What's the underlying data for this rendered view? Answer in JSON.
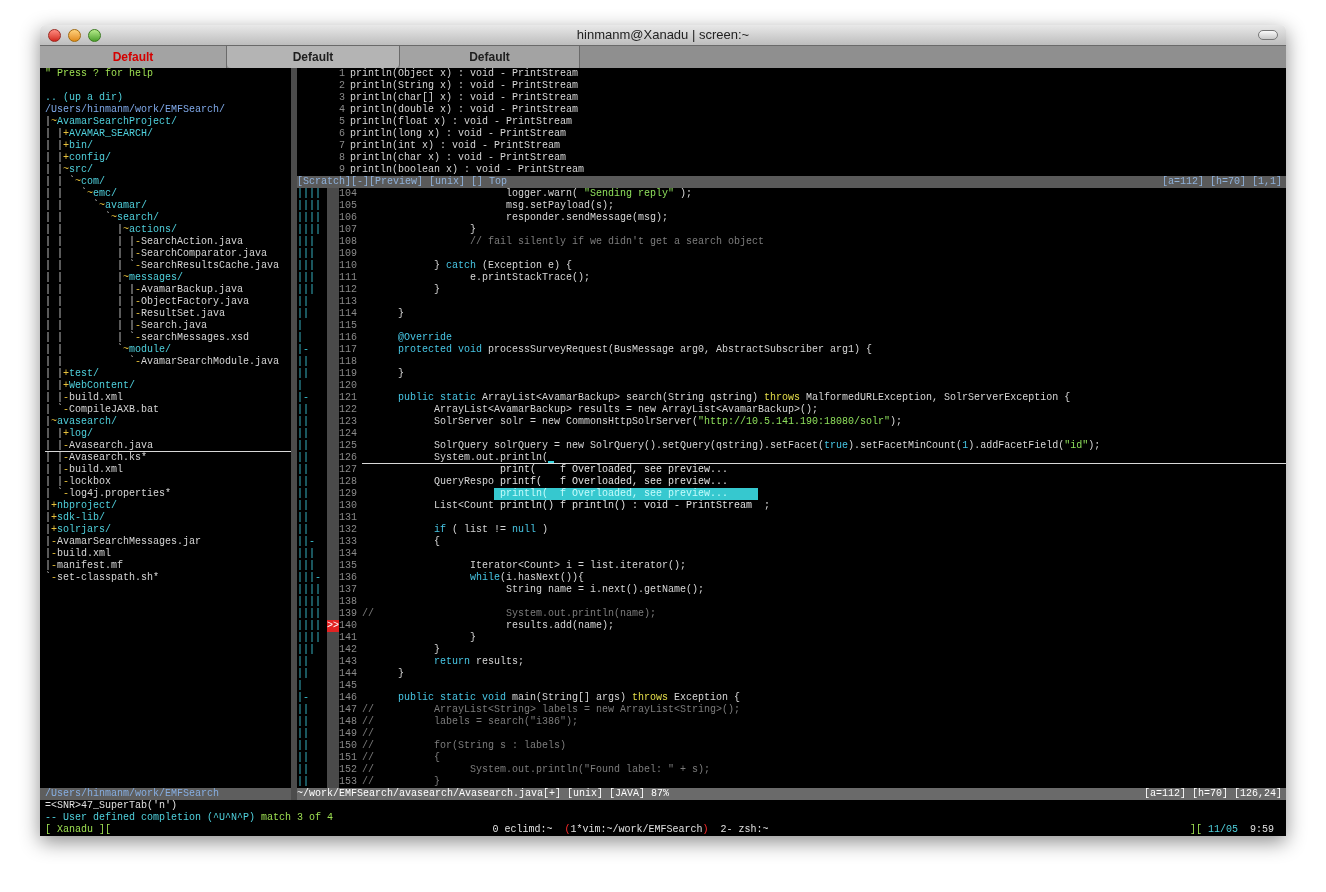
{
  "window": {
    "title": "hinmanm@Xanadu | screen:~"
  },
  "tabs": [
    {
      "label": "Default",
      "selected": false,
      "alert": true
    },
    {
      "label": "Default",
      "selected": true,
      "alert": false
    },
    {
      "label": "Default",
      "selected": false,
      "alert": false
    }
  ],
  "file_tree": {
    "help": "\" Press ? for help",
    "up": ".. (up a dir)",
    "root": "/Users/hinmanm/work/EMFSearch/",
    "nodes": [
      {
        "prefix": "|",
        "marker": "~",
        "name": "AvamarSearchProject/",
        "kind": "dir",
        "selected": false,
        "children": [
          {
            "prefix": "| |",
            "marker": "+",
            "name": "AVAMAR_SEARCH/",
            "kind": "dir",
            "selected": false
          },
          {
            "prefix": "| |",
            "marker": "+",
            "name": "bin/",
            "kind": "dir",
            "selected": false
          },
          {
            "prefix": "| |",
            "marker": "+",
            "name": "config/",
            "kind": "dir",
            "selected": false
          },
          {
            "prefix": "| |",
            "marker": "~",
            "name": "src/",
            "kind": "dir",
            "selected": false,
            "children": [
              {
                "prefix": "| | `",
                "marker": "~",
                "name": "com/",
                "kind": "dir",
                "selected": false,
                "children": [
                  {
                    "prefix": "| |   `",
                    "marker": "~",
                    "name": "emc/",
                    "kind": "dir",
                    "selected": false,
                    "children": [
                      {
                        "prefix": "| |     `",
                        "marker": "~",
                        "name": "avamar/",
                        "kind": "dir",
                        "selected": false,
                        "children": [
                          {
                            "prefix": "| |       `",
                            "marker": "~",
                            "name": "search/",
                            "kind": "dir",
                            "selected": false,
                            "children": [
                              {
                                "prefix": "| |         |",
                                "marker": "~",
                                "name": "actions/",
                                "kind": "dir",
                                "selected": false,
                                "children": [
                                  {
                                    "prefix": "| |         | |",
                                    "marker": "-",
                                    "name": "SearchAction.java",
                                    "kind": "file",
                                    "selected": false
                                  },
                                  {
                                    "prefix": "| |         | |",
                                    "marker": "-",
                                    "name": "SearchComparator.java",
                                    "kind": "file",
                                    "selected": false
                                  },
                                  {
                                    "prefix": "| |         | `",
                                    "marker": "-",
                                    "name": "SearchResultsCache.java",
                                    "kind": "file",
                                    "selected": false
                                  }
                                ]
                              },
                              {
                                "prefix": "| |         |",
                                "marker": "~",
                                "name": "messages/",
                                "kind": "dir",
                                "selected": false,
                                "children": [
                                  {
                                    "prefix": "| |         | |",
                                    "marker": "-",
                                    "name": "AvamarBackup.java",
                                    "kind": "file",
                                    "selected": false
                                  },
                                  {
                                    "prefix": "| |         | |",
                                    "marker": "-",
                                    "name": "ObjectFactory.java",
                                    "kind": "file",
                                    "selected": false
                                  },
                                  {
                                    "prefix": "| |         | |",
                                    "marker": "-",
                                    "name": "ResultSet.java",
                                    "kind": "file",
                                    "selected": false
                                  },
                                  {
                                    "prefix": "| |         | |",
                                    "marker": "-",
                                    "name": "Search.java",
                                    "kind": "file",
                                    "selected": false
                                  },
                                  {
                                    "prefix": "| |         | `",
                                    "marker": "-",
                                    "name": "searchMessages.xsd",
                                    "kind": "file",
                                    "selected": false
                                  }
                                ]
                              },
                              {
                                "prefix": "| |         `",
                                "marker": "~",
                                "name": "module/",
                                "kind": "dir",
                                "selected": false,
                                "children": [
                                  {
                                    "prefix": "| |           `",
                                    "marker": "-",
                                    "name": "AvamarSearchModule.java",
                                    "kind": "file",
                                    "selected": false
                                  }
                                ]
                              }
                            ]
                          }
                        ]
                      }
                    ]
                  }
                ]
              }
            ]
          },
          {
            "prefix": "| |",
            "marker": "+",
            "name": "test/",
            "kind": "dir",
            "selected": false
          },
          {
            "prefix": "| |",
            "marker": "+",
            "name": "WebContent/",
            "kind": "dir",
            "selected": false
          },
          {
            "prefix": "| |",
            "marker": "-",
            "name": "build.xml",
            "kind": "file",
            "selected": false
          },
          {
            "prefix": "| `",
            "marker": "-",
            "name": "CompileJAXB.bat",
            "kind": "file",
            "selected": false
          }
        ]
      },
      {
        "prefix": "|",
        "marker": "~",
        "name": "avasearch/",
        "kind": "dir",
        "selected": false,
        "children": [
          {
            "prefix": "| |",
            "marker": "+",
            "name": "log/",
            "kind": "dir",
            "selected": false
          },
          {
            "prefix": "| |",
            "marker": "-",
            "name": "Avasearch.java",
            "kind": "file",
            "selected": true
          },
          {
            "prefix": "| |",
            "marker": "-",
            "name": "Avasearch.ks*",
            "kind": "file",
            "selected": false
          },
          {
            "prefix": "| |",
            "marker": "-",
            "name": "build.xml",
            "kind": "file",
            "selected": false
          },
          {
            "prefix": "| |",
            "marker": "-",
            "name": "lockbox",
            "kind": "file",
            "selected": false
          },
          {
            "prefix": "| `",
            "marker": "-",
            "name": "log4j.properties*",
            "kind": "file",
            "selected": false
          }
        ]
      },
      {
        "prefix": "|",
        "marker": "+",
        "name": "nbproject/",
        "kind": "dir",
        "selected": false
      },
      {
        "prefix": "|",
        "marker": "+",
        "name": "sdk-lib/",
        "kind": "dir",
        "selected": false
      },
      {
        "prefix": "|",
        "marker": "+",
        "name": "solrjars/",
        "kind": "dir",
        "selected": false
      },
      {
        "prefix": "|",
        "marker": "-",
        "name": "AvamarSearchMessages.jar",
        "kind": "file",
        "selected": false
      },
      {
        "prefix": "|",
        "marker": "-",
        "name": "build.xml",
        "kind": "file",
        "selected": false
      },
      {
        "prefix": "|",
        "marker": "-",
        "name": "manifest.mf",
        "kind": "file",
        "selected": false
      },
      {
        "prefix": "`",
        "marker": "-",
        "name": "set-classpath.sh*",
        "kind": "file",
        "selected": false
      }
    ],
    "status": "/Users/hinmanm/work/EMFSearch"
  },
  "preview": {
    "lines": [
      {
        "num": "1",
        "text": "println(Object x) : void - PrintStream"
      },
      {
        "num": "2",
        "text": "println(String x) : void - PrintStream"
      },
      {
        "num": "3",
        "text": "println(char[] x) : void - PrintStream"
      },
      {
        "num": "4",
        "text": "println(double x) : void - PrintStream"
      },
      {
        "num": "5",
        "text": "println(float x) : void - PrintStream"
      },
      {
        "num": "6",
        "text": "println(long x) : void - PrintStream"
      },
      {
        "num": "7",
        "text": "println(int x) : void - PrintStream"
      },
      {
        "num": "8",
        "text": "println(char x) : void - PrintStream"
      },
      {
        "num": "9",
        "text": "println(boolean x) : void - PrintStream"
      }
    ],
    "status_left": "[Scratch][-][Preview] [unix] [] Top",
    "status_right": "[a=112] [h=70] [1,1]"
  },
  "editor": {
    "lines": [
      {
        "num": "104",
        "fold": "||||",
        "selected": false,
        "segments": [
          {
            "text": "                        logger.warn( ",
            "kind": "plain"
          },
          {
            "text": "\"Sending reply\"",
            "kind": "string"
          },
          {
            "text": " );",
            "kind": "plain"
          }
        ]
      },
      {
        "num": "105",
        "fold": "||||",
        "selected": false,
        "segments": [
          {
            "text": "                        msg.setPayload(s);",
            "kind": "plain"
          }
        ]
      },
      {
        "num": "106",
        "fold": "||||",
        "selected": false,
        "segments": [
          {
            "text": "                        responder.sendMessage(msg);",
            "kind": "plain"
          }
        ]
      },
      {
        "num": "107",
        "fold": "||||",
        "selected": false,
        "segments": [
          {
            "text": "                  }",
            "kind": "plain"
          }
        ]
      },
      {
        "num": "108",
        "fold": "|||",
        "selected": false,
        "segments": [
          {
            "text": "                  // fail silently if we didn't get a search object",
            "kind": "comment"
          }
        ]
      },
      {
        "num": "109",
        "fold": "|||",
        "selected": false
      },
      {
        "num": "110",
        "fold": "|||",
        "selected": false,
        "segments": [
          {
            "text": "            } ",
            "kind": "plain"
          },
          {
            "text": "catch",
            "kind": "keyword"
          },
          {
            "text": " (Exception e) {",
            "kind": "plain"
          }
        ]
      },
      {
        "num": "111",
        "fold": "|||",
        "selected": false,
        "segments": [
          {
            "text": "                  e.printStackTrace();",
            "kind": "plain"
          }
        ]
      },
      {
        "num": "112",
        "fold": "|||",
        "selected": false,
        "segments": [
          {
            "text": "            }",
            "kind": "plain"
          }
        ]
      },
      {
        "num": "113",
        "fold": "||",
        "selected": false
      },
      {
        "num": "114",
        "fold": "||",
        "selected": false,
        "segments": [
          {
            "text": "      }",
            "kind": "plain"
          }
        ]
      },
      {
        "num": "115",
        "fold": "|",
        "selected": false
      },
      {
        "num": "116",
        "fold": "|",
        "selected": false,
        "segments": [
          {
            "text": "      @Override",
            "kind": "keyword"
          }
        ]
      },
      {
        "num": "117",
        "fold": "|-",
        "selected": false,
        "segments": [
          {
            "text": "      protected void",
            "kind": "keyword"
          },
          {
            "text": " processSurveyRequest(BusMessage arg0, AbstractSubscriber arg1) {",
            "kind": "plain"
          }
        ]
      },
      {
        "num": "118",
        "fold": "||",
        "selected": false
      },
      {
        "num": "119",
        "fold": "||",
        "selected": false,
        "segments": [
          {
            "text": "      }",
            "kind": "plain"
          }
        ]
      },
      {
        "num": "120",
        "fold": "|",
        "selected": false
      },
      {
        "num": "121",
        "fold": "|-",
        "selected": false,
        "segments": [
          {
            "text": "      public static",
            "kind": "keyword"
          },
          {
            "text": " ArrayList<AvamarBackup> search(String qstring) ",
            "kind": "plain"
          },
          {
            "text": "throws",
            "kind": "special"
          },
          {
            "text": " MalformedURLException, SolrServerException {",
            "kind": "plain"
          }
        ]
      },
      {
        "num": "122",
        "fold": "||",
        "selected": false,
        "segments": [
          {
            "text": "            ArrayList<AvamarBackup> results = new ArrayList<AvamarBackup>();",
            "kind": "plain"
          }
        ]
      },
      {
        "num": "123",
        "fold": "||",
        "selected": false,
        "segments": [
          {
            "text": "            SolrServer solr = new CommonsHttpSolrServer(",
            "kind": "plain"
          },
          {
            "text": "\"http://10.5.141.190:18080/solr\"",
            "kind": "string"
          },
          {
            "text": ");",
            "kind": "plain"
          }
        ]
      },
      {
        "num": "124",
        "fold": "||",
        "selected": false
      },
      {
        "num": "125",
        "fold": "||",
        "selected": false,
        "segments": [
          {
            "text": "            SolrQuery solrQuery = new SolrQuery().setQuery(qstring).setFacet(",
            "kind": "plain"
          },
          {
            "text": "true",
            "kind": "keyword"
          },
          {
            "text": ").setFacetMinCount(",
            "kind": "plain"
          },
          {
            "text": "1",
            "kind": "keyword"
          },
          {
            "text": ").addFacetField(",
            "kind": "plain"
          },
          {
            "text": "\"id\"",
            "kind": "string"
          },
          {
            "text": ");",
            "kind": "plain"
          }
        ]
      },
      {
        "num": "126",
        "fold": "||",
        "selected": true,
        "segments": [
          {
            "text": "            System.out.println(",
            "kind": "plain"
          }
        ]
      },
      {
        "num": "127",
        "fold": "||",
        "selected": false,
        "completion": {
          "word": "print(",
          "flag": "f",
          "info": "Overloaded, see preview...",
          "selected": false
        }
      },
      {
        "num": "128",
        "fold": "||",
        "selected": false,
        "segments": [
          {
            "text": "            QueryRespo",
            "kind": "plain"
          }
        ],
        "completion": {
          "word": "printf(",
          "flag": "f",
          "info": "Overloaded, see preview...",
          "selected": false
        }
      },
      {
        "num": "129",
        "fold": "||",
        "selected": false,
        "completion": {
          "word": "println(",
          "flag": "f",
          "info": "Overloaded, see preview...",
          "selected": true
        }
      },
      {
        "num": "130",
        "fold": "||",
        "selected": false,
        "segments": [
          {
            "text": "            List<Count",
            "kind": "plain"
          }
        ],
        "completion": {
          "word": "println()",
          "flag": "f",
          "info": "println() : void - PrintStream",
          "selected": false
        },
        "after": [
          {
            "text": ";",
            "kind": "plain"
          }
        ]
      },
      {
        "num": "131",
        "fold": "||",
        "selected": false
      },
      {
        "num": "132",
        "fold": "||",
        "selected": false,
        "segments": [
          {
            "text": "            if",
            "kind": "keyword"
          },
          {
            "text": " ( list != ",
            "kind": "plain"
          },
          {
            "text": "null",
            "kind": "keyword"
          },
          {
            "text": " )",
            "kind": "plain"
          }
        ]
      },
      {
        "num": "133",
        "fold": "||-",
        "selected": false,
        "segments": [
          {
            "text": "            {",
            "kind": "plain"
          }
        ]
      },
      {
        "num": "134",
        "fold": "|||",
        "selected": false
      },
      {
        "num": "135",
        "fold": "|||",
        "selected": false,
        "segments": [
          {
            "text": "                  Iterator<Count> i = list.iterator();",
            "kind": "plain"
          }
        ]
      },
      {
        "num": "136",
        "fold": "|||-",
        "selected": false,
        "segments": [
          {
            "text": "                  while",
            "kind": "keyword"
          },
          {
            "text": "(i.hasNext()){",
            "kind": "plain"
          }
        ]
      },
      {
        "num": "137",
        "fold": "||||",
        "selected": false,
        "segments": [
          {
            "text": "                        String name = i.next().getName();",
            "kind": "plain"
          }
        ]
      },
      {
        "num": "138",
        "fold": "||||",
        "selected": false
      },
      {
        "num": "139",
        "fold": "||||",
        "selected": false,
        "segments": [
          {
            "text": "//                      System.out.println(name);",
            "kind": "comment"
          }
        ]
      },
      {
        "num": "140",
        "fold": "||||",
        "selected": false,
        "sign": ">>",
        "segments": [
          {
            "text": "                        results.add(name);",
            "kind": "plain"
          }
        ]
      },
      {
        "num": "141",
        "fold": "||||",
        "selected": false,
        "segments": [
          {
            "text": "                  }",
            "kind": "plain"
          }
        ]
      },
      {
        "num": "142",
        "fold": "|||",
        "selected": false,
        "segments": [
          {
            "text": "            }",
            "kind": "plain"
          }
        ]
      },
      {
        "num": "143",
        "fold": "||",
        "selected": false,
        "segments": [
          {
            "text": "            return",
            "kind": "keyword"
          },
          {
            "text": " results;",
            "kind": "plain"
          }
        ]
      },
      {
        "num": "144",
        "fold": "||",
        "selected": false,
        "segments": [
          {
            "text": "      }",
            "kind": "plain"
          }
        ]
      },
      {
        "num": "145",
        "fold": "|",
        "selected": false
      },
      {
        "num": "146",
        "fold": "|-",
        "selected": false,
        "segments": [
          {
            "text": "      public static void",
            "kind": "keyword"
          },
          {
            "text": " main(String[] args) ",
            "kind": "plain"
          },
          {
            "text": "throws",
            "kind": "special"
          },
          {
            "text": " Exception {",
            "kind": "plain"
          }
        ]
      },
      {
        "num": "147",
        "fold": "||",
        "selected": false,
        "segments": [
          {
            "text": "//          ArrayList<String> labels = new ArrayList<String>();",
            "kind": "comment"
          }
        ]
      },
      {
        "num": "148",
        "fold": "||",
        "selected": false,
        "segments": [
          {
            "text": "//          labels = search(\"i386\");",
            "kind": "comment"
          }
        ]
      },
      {
        "num": "149",
        "fold": "||",
        "selected": false,
        "segments": [
          {
            "text": "//",
            "kind": "comment"
          }
        ]
      },
      {
        "num": "150",
        "fold": "||",
        "selected": false,
        "segments": [
          {
            "text": "//          for(String s : labels)",
            "kind": "comment"
          }
        ]
      },
      {
        "num": "151",
        "fold": "||",
        "selected": false,
        "segments": [
          {
            "text": "//          {",
            "kind": "comment"
          }
        ]
      },
      {
        "num": "152",
        "fold": "||",
        "selected": false,
        "segments": [
          {
            "text": "//                System.out.println(\"Found label: \" + s);",
            "kind": "comment"
          }
        ]
      },
      {
        "num": "153",
        "fold": "||",
        "selected": false,
        "segments": [
          {
            "text": "//          }",
            "kind": "comment"
          }
        ]
      }
    ],
    "status_left": "~/work/EMFSearch/avasearch/Avasearch.java[+] [unix] [JAVA] 87%",
    "status_right": "[a=112] [h=70] [126,24]"
  },
  "command_line": "=<SNR>47_SuperTab('n')",
  "message": {
    "mode": "-- User defined completion (^U^N^P)",
    "match": "match 3 of 4"
  },
  "screen_bar": {
    "host": "[ Xanadu ][",
    "current_marks": [
      "(",
      ")"
    ],
    "windows": [
      {
        "label": "0 eclimd:~",
        "selected": false
      },
      {
        "label": "1*vim:~/work/EMFSearch",
        "selected": true
      },
      {
        "label": "2- zsh:~",
        "selected": false
      }
    ],
    "right_bracket": "][",
    "date": "11/05",
    "time": "9:59"
  }
}
